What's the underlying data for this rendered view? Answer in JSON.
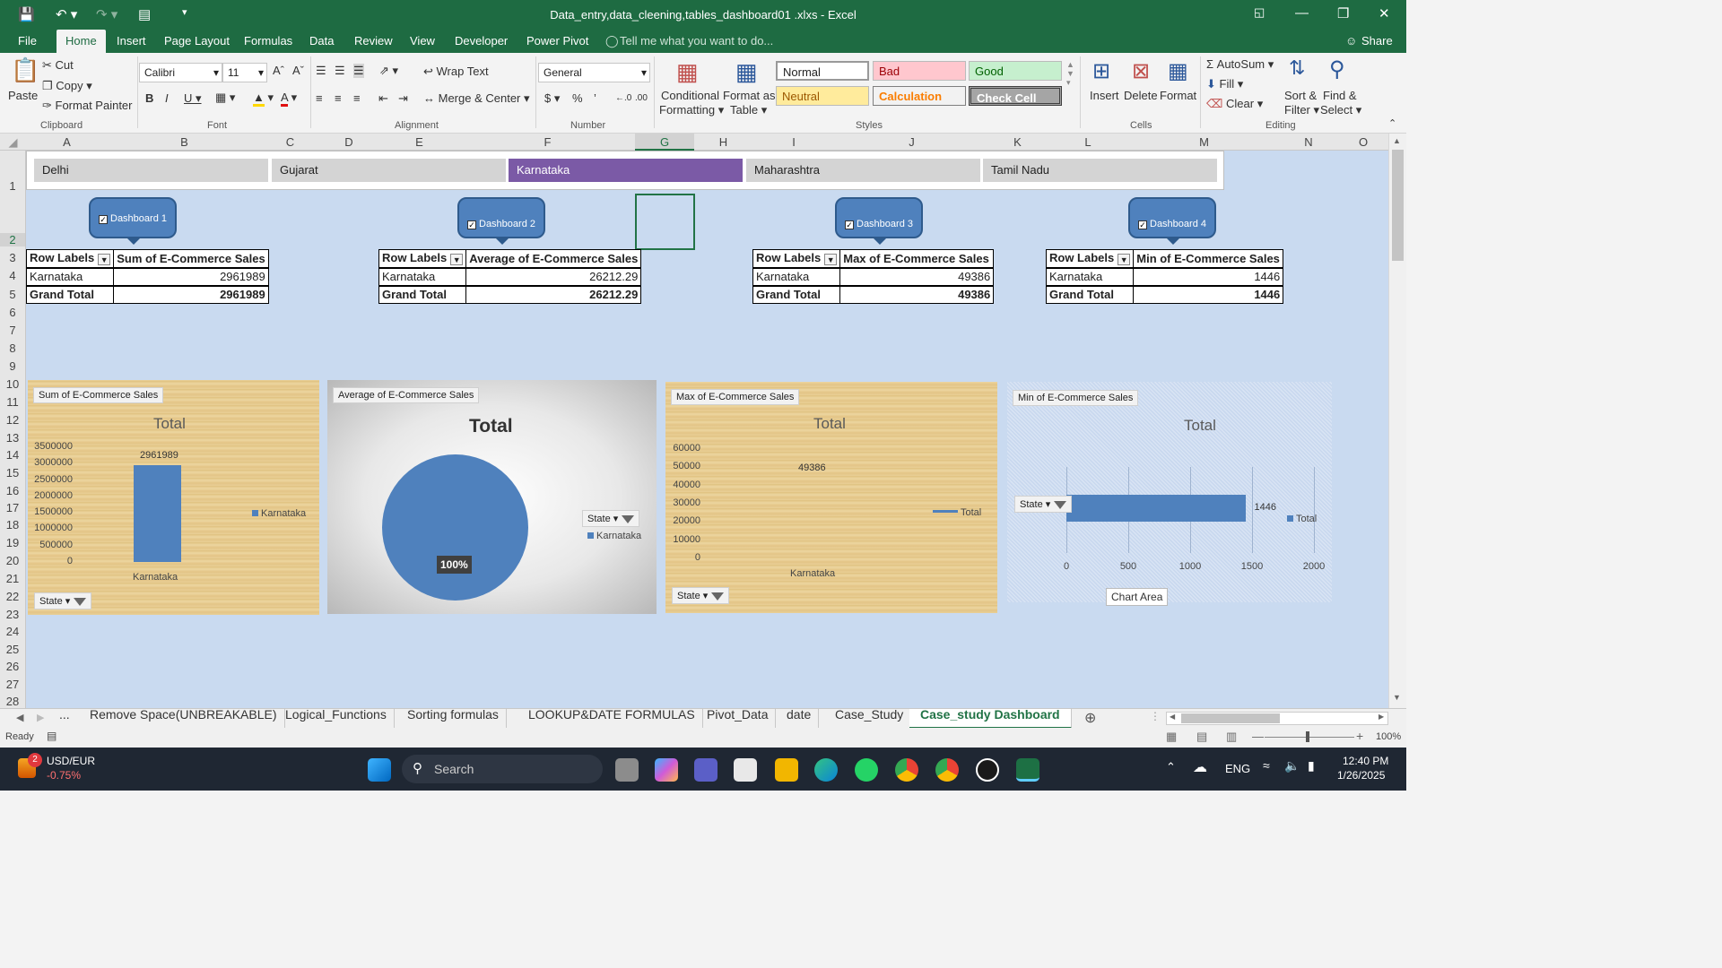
{
  "titlebar": {
    "doc_title": "Data_entry,data_cleening,tables_dashboard01 .xlxs  -  Excel"
  },
  "menu": [
    "File",
    "Home",
    "Insert",
    "Page Layout",
    "Formulas",
    "Data",
    "Review",
    "View",
    "Developer",
    "Power Pivot",
    "Tell me what you want to do...",
    "Share"
  ],
  "ribbon": {
    "clipboard": {
      "paste": "Paste",
      "cut": "Cut",
      "copy": "Copy",
      "format_painter": "Format Painter",
      "group": "Clipboard"
    },
    "font": {
      "name": "Calibri",
      "size": "11",
      "group": "Font"
    },
    "alignment": {
      "wrap": "Wrap Text",
      "merge": "Merge & Center",
      "group": "Alignment"
    },
    "number": {
      "format": "General",
      "group": "Number"
    },
    "styles": {
      "cond": "Conditional",
      "cond2": "Formatting",
      "fmt_table": "Format as",
      "fmt_table2": "Table",
      "normal": "Normal",
      "bad": "Bad",
      "good": "Good",
      "neutral": "Neutral",
      "calculation": "Calculation",
      "check": "Check Cell",
      "group": "Styles"
    },
    "cells": {
      "insert": "Insert",
      "delete": "Delete",
      "format": "Format",
      "group": "Cells"
    },
    "editing": {
      "autosum": "AutoSum",
      "fill": "Fill",
      "clear": "Clear",
      "sort": "Sort &",
      "sort2": "Filter",
      "find": "Find &",
      "find2": "Select",
      "group": "Editing"
    }
  },
  "columns": [
    "A",
    "B",
    "C",
    "D",
    "E",
    "F",
    "G",
    "H",
    "I",
    "J",
    "K",
    "L",
    "M",
    "N",
    "O"
  ],
  "rows": [
    "1",
    "2",
    "3",
    "4",
    "5",
    "6",
    "7",
    "8",
    "9",
    "10",
    "11",
    "12",
    "13",
    "14",
    "15",
    "16",
    "17",
    "18",
    "19",
    "20",
    "21",
    "22",
    "23",
    "24",
    "25",
    "26",
    "27",
    "28"
  ],
  "slicer": {
    "items": [
      "Delhi",
      "Gujarat",
      "Karnataka",
      "Maharashtra",
      "Tamil Nadu"
    ],
    "selected": "Karnataka"
  },
  "dashboards": [
    "Dashboard 1",
    "Dashboard 2",
    "Dashboard 3",
    "Dashboard 4"
  ],
  "pivots": [
    {
      "h1": "Row Labels",
      "h2": "Sum of E-Commerce Sales",
      "r1": "Karnataka",
      "v1": "2961989",
      "t": "Grand Total",
      "tv": "2961989"
    },
    {
      "h1": "Row Labels",
      "h2": "Average of E-Commerce Sales",
      "r1": "Karnataka",
      "v1": "26212.29",
      "t": "Grand Total",
      "tv": "26212.29"
    },
    {
      "h1": "Row Labels",
      "h2": "Max of E-Commerce Sales",
      "r1": "Karnataka",
      "v1": "49386",
      "t": "Grand Total",
      "tv": "49386"
    },
    {
      "h1": "Row Labels",
      "h2": "Min of E-Commerce Sales",
      "r1": "Karnataka",
      "v1": "1446",
      "t": "Grand Total",
      "tv": "1446"
    }
  ],
  "charts": {
    "c1": {
      "tag": "Sum of E-Commerce Sales",
      "title": "Total",
      "ticks": [
        "3500000",
        "3000000",
        "2500000",
        "2000000",
        "1500000",
        "1000000",
        "500000",
        "0"
      ],
      "cat": "Karnataka",
      "label": "2961989",
      "legend": "Karnataka",
      "state": "State"
    },
    "c2": {
      "tag": "Average of E-Commerce Sales",
      "title": "Total",
      "label": "100%",
      "legend": "Karnataka",
      "state": "State"
    },
    "c3": {
      "tag": "Max of E-Commerce Sales",
      "title": "Total",
      "ticks": [
        "60000",
        "50000",
        "40000",
        "30000",
        "20000",
        "10000",
        "0"
      ],
      "cat": "Karnataka",
      "label": "49386",
      "legend": "Total",
      "state": "State"
    },
    "c4": {
      "tag": "Min of E-Commerce Sales",
      "title": "Total",
      "ticks": [
        "0",
        "500",
        "1000",
        "1500",
        "2000"
      ],
      "label": "1446",
      "legend": "Total",
      "state": "State",
      "tooltip": "Chart Area"
    }
  },
  "chart_data": [
    {
      "type": "bar",
      "title": "Total",
      "categories": [
        "Karnataka"
      ],
      "values": [
        2961989
      ],
      "ylim": [
        0,
        3500000
      ],
      "legend": "right"
    },
    {
      "type": "pie",
      "title": "Total",
      "categories": [
        "Karnataka"
      ],
      "values": [
        100
      ],
      "legend": "right"
    },
    {
      "type": "line",
      "title": "Total",
      "categories": [
        "Karnataka"
      ],
      "values": [
        49386
      ],
      "ylim": [
        0,
        60000
      ],
      "legend": "right"
    },
    {
      "type": "bar",
      "title": "Total",
      "categories": [
        "Karnataka"
      ],
      "values": [
        1446
      ],
      "xlim": [
        0,
        2000
      ],
      "legend": "right"
    }
  ],
  "sheet_tabs": [
    "...",
    "Remove Space(UNBREAKABLE)",
    "Logical_Functions",
    "Sorting formulas",
    "LOOKUP&DATE FORMULAS",
    "Pivot_Data",
    "date",
    "Case_Study",
    "Case_study Dashboard"
  ],
  "status": {
    "ready": "Ready",
    "zoom": "100%"
  },
  "taskbar": {
    "ticker": "USD/EUR",
    "change": "-0.75%",
    "badge": "2",
    "search": "Search",
    "lang": "ENG",
    "time": "12:40 PM",
    "date": "1/26/2025"
  },
  "colors": {
    "excel_green": "#1e6b42",
    "slicer_selected": "#7b5aa6",
    "series": "#4f81bd",
    "sheet_bg": "#c9daf0"
  }
}
